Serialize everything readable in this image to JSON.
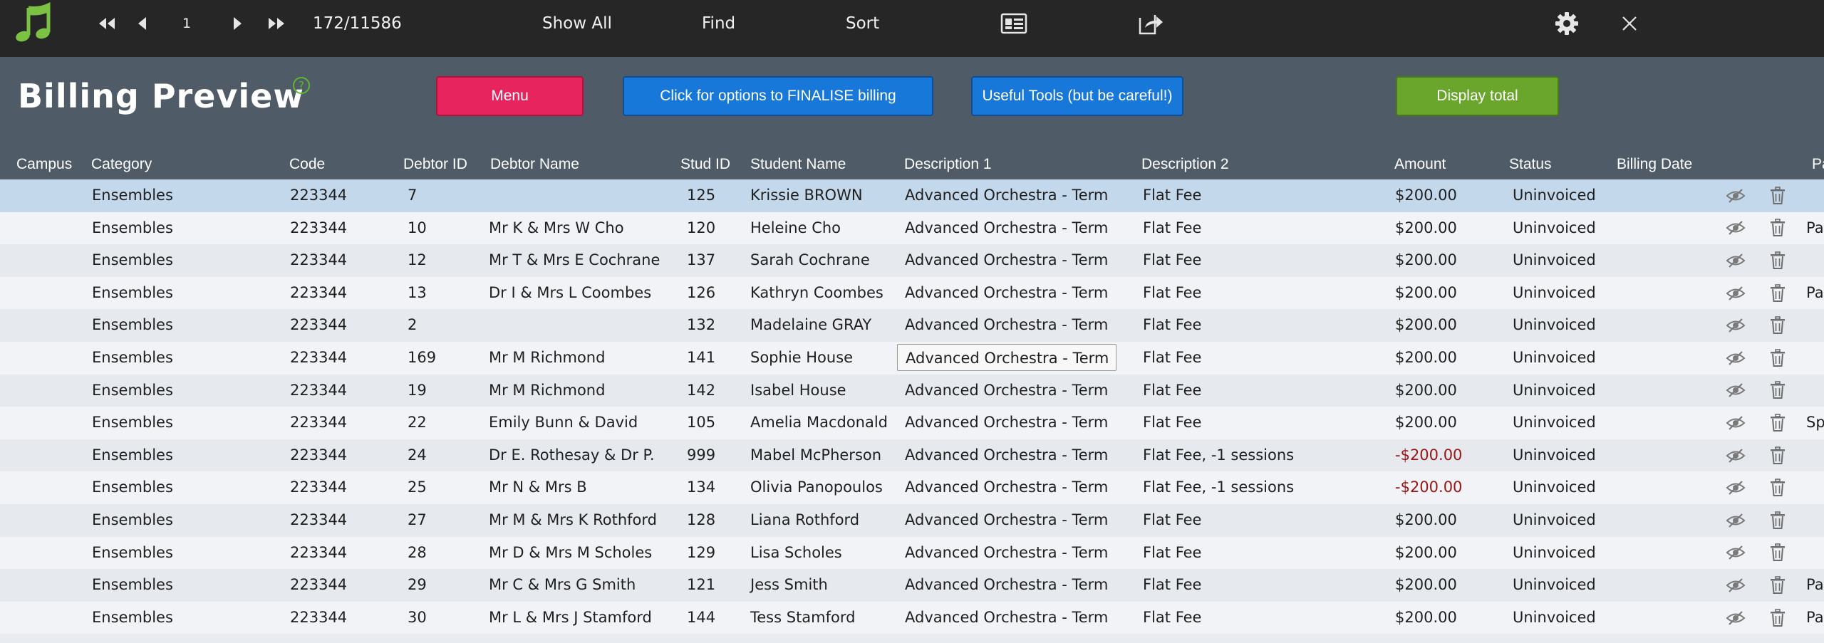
{
  "toolbar": {
    "record_number": "1",
    "record_count": "172/11586",
    "show_all": "Show All",
    "find": "Find",
    "sort": "Sort"
  },
  "header": {
    "title": "Billing Preview",
    "help": "?",
    "menu": "Menu",
    "finalise": "Click for options to FINALISE billing",
    "tools": "Useful Tools (but be careful!)",
    "display_total": "Display total"
  },
  "columns": {
    "campus": "Campus",
    "category": "Category",
    "code": "Code",
    "debtor_id": "Debtor ID",
    "debtor_name": "Debtor Name",
    "stud_id": "Stud ID",
    "student_name": "Student Name",
    "description1": "Description 1",
    "description2": "Description 2",
    "amount": "Amount",
    "status": "Status",
    "billing_date": "Billing Date",
    "extra": "Pa"
  },
  "rows": [
    {
      "category": "Ensembles",
      "code": "223344",
      "debtor_id": "7",
      "debtor_name": "",
      "stud_id": "125",
      "student_name": "Krissie BROWN",
      "description1": "Advanced Orchestra - Term",
      "description2": "Flat Fee",
      "amount": "$200.00",
      "status": "Uninvoiced",
      "extra": ""
    },
    {
      "category": "Ensembles",
      "code": "223344",
      "debtor_id": "10",
      "debtor_name": "Mr K & Mrs W Cho",
      "stud_id": "120",
      "student_name": "Heleine Cho",
      "description1": "Advanced Orchestra - Term",
      "description2": "Flat Fee",
      "amount": "$200.00",
      "status": "Uninvoiced",
      "extra": "Pa"
    },
    {
      "category": "Ensembles",
      "code": "223344",
      "debtor_id": "12",
      "debtor_name": "Mr T & Mrs E Cochrane",
      "stud_id": "137",
      "student_name": "Sarah Cochrane",
      "description1": "Advanced Orchestra - Term",
      "description2": "Flat Fee",
      "amount": "$200.00",
      "status": "Uninvoiced",
      "extra": ""
    },
    {
      "category": "Ensembles",
      "code": "223344",
      "debtor_id": "13",
      "debtor_name": "Dr I & Mrs L Coombes",
      "stud_id": "126",
      "student_name": "Kathryn Coombes",
      "description1": "Advanced Orchestra - Term",
      "description2": "Flat Fee",
      "amount": "$200.00",
      "status": "Uninvoiced",
      "extra": "Pa"
    },
    {
      "category": "Ensembles",
      "code": "223344",
      "debtor_id": "2",
      "debtor_name": "",
      "stud_id": "132",
      "student_name": "Madelaine GRAY",
      "description1": "Advanced Orchestra - Term",
      "description2": "Flat Fee",
      "amount": "$200.00",
      "status": "Uninvoiced",
      "extra": ""
    },
    {
      "category": "Ensembles",
      "code": "223344",
      "debtor_id": "169",
      "debtor_name": "Mr M Richmond",
      "stud_id": "141",
      "student_name": "Sophie House",
      "description1": "Advanced Orchestra - Term",
      "description2": "Flat Fee",
      "amount": "$200.00",
      "status": "Uninvoiced",
      "extra": ""
    },
    {
      "category": "Ensembles",
      "code": "223344",
      "debtor_id": "19",
      "debtor_name": "Mr M Richmond",
      "stud_id": "142",
      "student_name": "Isabel House",
      "description1": "Advanced Orchestra - Term",
      "description2": "Flat Fee",
      "amount": "$200.00",
      "status": "Uninvoiced",
      "extra": ""
    },
    {
      "category": "Ensembles",
      "code": "223344",
      "debtor_id": "22",
      "debtor_name": "Emily Bunn & David",
      "stud_id": "105",
      "student_name": "Amelia Macdonald",
      "description1": "Advanced Orchestra - Term",
      "description2": "Flat Fee",
      "amount": "$200.00",
      "status": "Uninvoiced",
      "extra": "Sp"
    },
    {
      "category": "Ensembles",
      "code": "223344",
      "debtor_id": "24",
      "debtor_name": "Dr E. Rothesay & Dr P.",
      "stud_id": "999",
      "student_name": "Mabel McPherson",
      "description1": "Advanced Orchestra - Term",
      "description2": "Flat Fee, -1 sessions",
      "amount": "-$200.00",
      "status": "Uninvoiced",
      "extra": ""
    },
    {
      "category": "Ensembles",
      "code": "223344",
      "debtor_id": "25",
      "debtor_name": "Mr N & Mrs B",
      "stud_id": "134",
      "student_name": "Olivia Panopoulos",
      "description1": "Advanced Orchestra - Term",
      "description2": "Flat Fee, -1 sessions",
      "amount": "-$200.00",
      "status": "Uninvoiced",
      "extra": ""
    },
    {
      "category": "Ensembles",
      "code": "223344",
      "debtor_id": "27",
      "debtor_name": "Mr M & Mrs K Rothford",
      "stud_id": "128",
      "student_name": "Liana Rothford",
      "description1": "Advanced Orchestra - Term",
      "description2": "Flat Fee",
      "amount": "$200.00",
      "status": "Uninvoiced",
      "extra": ""
    },
    {
      "category": "Ensembles",
      "code": "223344",
      "debtor_id": "28",
      "debtor_name": "Mr D & Mrs M Scholes",
      "stud_id": "129",
      "student_name": "Lisa Scholes",
      "description1": "Advanced Orchestra - Term",
      "description2": "Flat Fee",
      "amount": "$200.00",
      "status": "Uninvoiced",
      "extra": ""
    },
    {
      "category": "Ensembles",
      "code": "223344",
      "debtor_id": "29",
      "debtor_name": "Mr C & Mrs G Smith",
      "stud_id": "121",
      "student_name": "Jess Smith",
      "description1": "Advanced Orchestra - Term",
      "description2": "Flat Fee",
      "amount": "$200.00",
      "status": "Uninvoiced",
      "extra": "Pa"
    },
    {
      "category": "Ensembles",
      "code": "223344",
      "debtor_id": "30",
      "debtor_name": "Mr L & Mrs J Stamford",
      "stud_id": "144",
      "student_name": "Tess Stamford",
      "description1": "Advanced Orchestra - Term",
      "description2": "Flat Fee",
      "amount": "$200.00",
      "status": "Uninvoiced",
      "extra": "Pa"
    }
  ],
  "icons": {
    "logo": "music-note-icon",
    "row_hide": "eye-slash-icon",
    "row_delete": "trash-icon"
  },
  "colors": {
    "toolbar_bg": "#262626",
    "header_bg": "#4f5b67",
    "menu_button": "#e8245f",
    "primary_button": "#1778d9",
    "total_button": "#6aa52c",
    "selected_row": "#c4d8ec",
    "negative_amount": "#9b1414",
    "logo_green": "#7cc242"
  }
}
